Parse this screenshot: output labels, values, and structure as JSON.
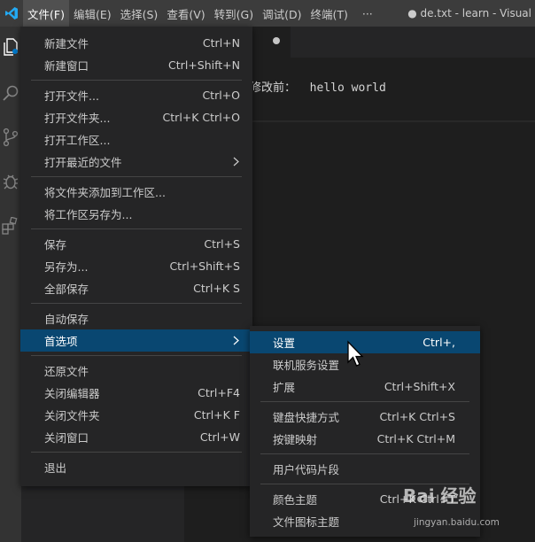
{
  "titlebar": {
    "menus": [
      "文件(F)",
      "编辑(E)",
      "选择(S)",
      "查看(V)",
      "转到(G)",
      "调试(D)",
      "终端(T)",
      "···"
    ],
    "window_title": "● de.txt - learn - Visual"
  },
  "activity_bar": {
    "icons": [
      "explorer-icon",
      "search-icon",
      "source-control-icon",
      "debug-icon",
      "extensions-icon"
    ]
  },
  "editor": {
    "line_label": "修改前：",
    "line_text": "hello world"
  },
  "file_menu": {
    "groups": [
      [
        {
          "label": "新建文件",
          "shortcut": "Ctrl+N"
        },
        {
          "label": "新建窗口",
          "shortcut": "Ctrl+Shift+N"
        }
      ],
      [
        {
          "label": "打开文件...",
          "shortcut": "Ctrl+O"
        },
        {
          "label": "打开文件夹...",
          "shortcut": "Ctrl+K Ctrl+O"
        },
        {
          "label": "打开工作区...",
          "shortcut": ""
        },
        {
          "label": "打开最近的文件",
          "shortcut": "",
          "submenu": true
        }
      ],
      [
        {
          "label": "将文件夹添加到工作区...",
          "shortcut": ""
        },
        {
          "label": "将工作区另存为...",
          "shortcut": ""
        }
      ],
      [
        {
          "label": "保存",
          "shortcut": "Ctrl+S"
        },
        {
          "label": "另存为...",
          "shortcut": "Ctrl+Shift+S"
        },
        {
          "label": "全部保存",
          "shortcut": "Ctrl+K S"
        }
      ],
      [
        {
          "label": "自动保存",
          "shortcut": ""
        },
        {
          "label": "首选项",
          "shortcut": "",
          "submenu": true,
          "highlighted": true
        }
      ],
      [
        {
          "label": "还原文件",
          "shortcut": ""
        },
        {
          "label": "关闭编辑器",
          "shortcut": "Ctrl+F4"
        },
        {
          "label": "关闭文件夹",
          "shortcut": "Ctrl+K F"
        },
        {
          "label": "关闭窗口",
          "shortcut": "Ctrl+W"
        }
      ],
      [
        {
          "label": "退出",
          "shortcut": ""
        }
      ]
    ]
  },
  "prefs_menu": {
    "groups": [
      [
        {
          "label": "设置",
          "shortcut": "Ctrl+,",
          "highlighted": true
        },
        {
          "label": "联机服务设置",
          "shortcut": ""
        },
        {
          "label": "扩展",
          "shortcut": "Ctrl+Shift+X"
        }
      ],
      [
        {
          "label": "键盘快捷方式",
          "shortcut": "Ctrl+K Ctrl+S"
        },
        {
          "label": "按键映射",
          "shortcut": "Ctrl+K Ctrl+M"
        }
      ],
      [
        {
          "label": "用户代码片段",
          "shortcut": ""
        }
      ],
      [
        {
          "label": "颜色主题",
          "shortcut": "Ctrl+K Ctrl+T"
        },
        {
          "label": "文件图标主题",
          "shortcut": ""
        }
      ]
    ]
  },
  "colors": {
    "menu_bg": "#252526",
    "highlight": "#094771",
    "titlebar": "#3c3c3c",
    "vscode_blue": "#007acc"
  },
  "watermark": {
    "text": "Bai 经验",
    "sub": "jingyan.baidu.com"
  }
}
